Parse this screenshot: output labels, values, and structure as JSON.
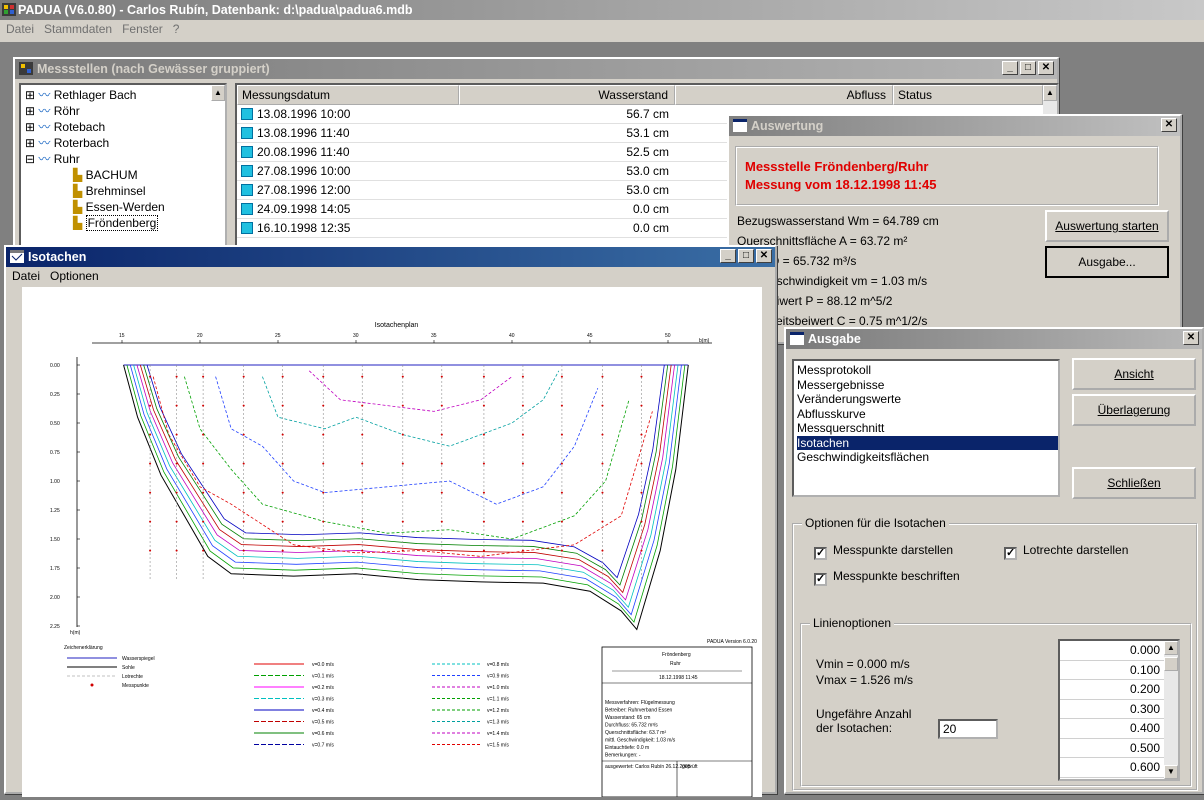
{
  "app": {
    "title": "PADUA (V6.0.80) - Carlos Rubín, Datenbank: d:\\padua\\padua6.mdb",
    "menu": [
      "Datei",
      "Stammdaten",
      "Fenster",
      "?"
    ]
  },
  "messstellen": {
    "title": "Messstellen (nach Gewässer gruppiert)",
    "tree": [
      "Rethlager Bach",
      "Röhr",
      "Rotebach",
      "Roterbach",
      "Ruhr",
      "BACHUM",
      "Brehminsel",
      "Essen-Werden",
      "Fröndenberg"
    ],
    "columns": [
      "Messungsdatum",
      "Wasserstand",
      "Abfluss",
      "Status"
    ],
    "rows": [
      [
        "13.08.1996 10:00",
        "56.7 cm"
      ],
      [
        "13.08.1996 11:40",
        "53.1 cm"
      ],
      [
        "20.08.1996 11:40",
        "52.5 cm"
      ],
      [
        "27.08.1996 10:00",
        "53.0 cm"
      ],
      [
        "27.08.1996 12:00",
        "53.0 cm"
      ],
      [
        "24.09.1998 14:05",
        "0.0 cm"
      ],
      [
        "16.10.1998 12:35",
        "0.0 cm"
      ]
    ]
  },
  "auswertung": {
    "title": "Auswertung",
    "header1": "Messstelle Fröndenberg/Ruhr",
    "header2": "Messung vom 18.12.1998 11:45",
    "lines": [
      "Bezugswasserstand Wm = 64.789 cm",
      "Querschnittsfläche A = 63.72 m²",
      "Q = 65.732 m³/s",
      "eschwindigkeit vm = 1.03 m/s",
      "eiwert P = 88.12 m^5/2",
      "keitsbeiwert C = 0.75 m^1/2/s"
    ],
    "btn_start": "Auswertung starten",
    "btn_ausgabe": "Ausgabe..."
  },
  "ausgabe": {
    "title": "Ausgabe",
    "list": [
      "Messprotokoll",
      "Messergebnisse",
      "Veränderungswerte",
      "Abflusskurve",
      "Messquerschnitt",
      "Isotachen",
      "Geschwindigkeitsflächen"
    ],
    "selected": 5,
    "btn_ansicht": "Ansicht",
    "btn_ueber": "Überlagerung",
    "btn_close": "Schließen",
    "group_title": "Optionen für die Isotachen",
    "cb1": "Messpunkte darstellen",
    "cb2": "Lotrechte darstellen",
    "cb3": "Messpunkte beschriften",
    "lin_title": "Linienoptionen",
    "vmin": "Vmin = 0.000 m/s",
    "vmax": "Vmax = 1.526 m/s",
    "anzahl1": "Ungefähre Anzahl",
    "anzahl2": "der Isotachen:",
    "anzahl_val": "20",
    "levels": [
      "0.000",
      "0.100",
      "0.200",
      "0.300",
      "0.400",
      "0.500",
      "0.600"
    ]
  },
  "isotachen": {
    "title": "Isotachen",
    "menu": [
      "Datei",
      "Optionen"
    ],
    "chart_title": "Isotachenplan",
    "x_ticks": [
      "15",
      "20",
      "25",
      "30",
      "35",
      "40",
      "45",
      "50"
    ],
    "x_unit": "b(m)",
    "y_ticks": [
      "0.00",
      "0.25",
      "0.50",
      "0.75",
      "1.00",
      "1.25",
      "1.50",
      "1.75",
      "2.00",
      "2.25"
    ],
    "y_unit": "h(m)",
    "legend_title": "Zeichenerklärung",
    "legend_left": [
      "Wasserspiegel",
      "Sohle",
      "Lotrechte",
      "Messpunkte"
    ],
    "legend_mid": [
      "v=0.0 m/s",
      "v=0.1 m/s",
      "v=0.2 m/s",
      "v=0.3 m/s",
      "v=0.4 m/s",
      "v=0.5 m/s",
      "v=0.6 m/s",
      "v=0.7 m/s"
    ],
    "legend_right": [
      "v=0.8 m/s",
      "v=0.9 m/s",
      "v=1.0 m/s",
      "v=1.1 m/s",
      "v=1.2 m/s",
      "v=1.3 m/s",
      "v=1.4 m/s",
      "v=1.5 m/s"
    ],
    "box_brand": "PADUA Version 6.0.20",
    "box_head1": "Fröndenberg",
    "box_head2": "Ruhr",
    "box_head3": "18.12.1998 11:45",
    "box_lines": [
      "Messverfahren: Flügelmessung",
      "Betreiber: Ruhrverband Essen",
      "Wasserstand: 65 cm",
      "Durchfluss: 65.732 m³/s",
      "Querschnittsfläche: 63.7 m²",
      "mittl. Geschwindigkeit: 1.03 m/s",
      "Eintauchtiefe: 0.0 m",
      "Bemerkungen: -"
    ],
    "box_foot1": "ausgewertet: Carlos Rubín 26.12.2005",
    "box_foot2": "geprüft"
  }
}
